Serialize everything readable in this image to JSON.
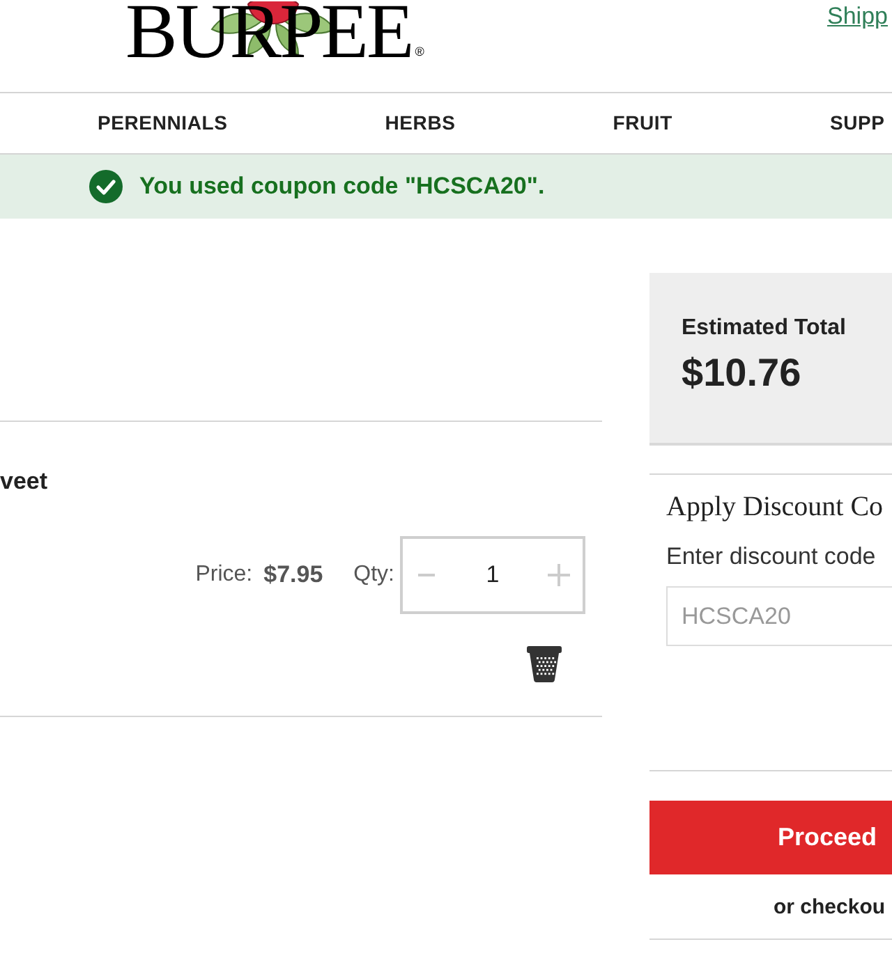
{
  "header": {
    "logo": {
      "text": "BURPEE",
      "mark": "®"
    },
    "shipping_link": "Shipp"
  },
  "nav": {
    "items": [
      "PERENNIALS",
      "HERBS",
      "FRUIT",
      "SUPP"
    ]
  },
  "banner": {
    "message": "You used coupon code \"HCSCA20\"."
  },
  "cart_item": {
    "name": "veet",
    "price_label": "Price:",
    "price": "$7.95",
    "qty_label": "Qty:",
    "quantity": "1"
  },
  "summary": {
    "total_label": "Estimated Total",
    "total": "$10.76"
  },
  "discount": {
    "title": "Apply Discount Co",
    "field_label": "Enter discount code",
    "placeholder": "HCSCA20"
  },
  "checkout": {
    "button": "Proceed",
    "alt_text": "or checkou"
  }
}
